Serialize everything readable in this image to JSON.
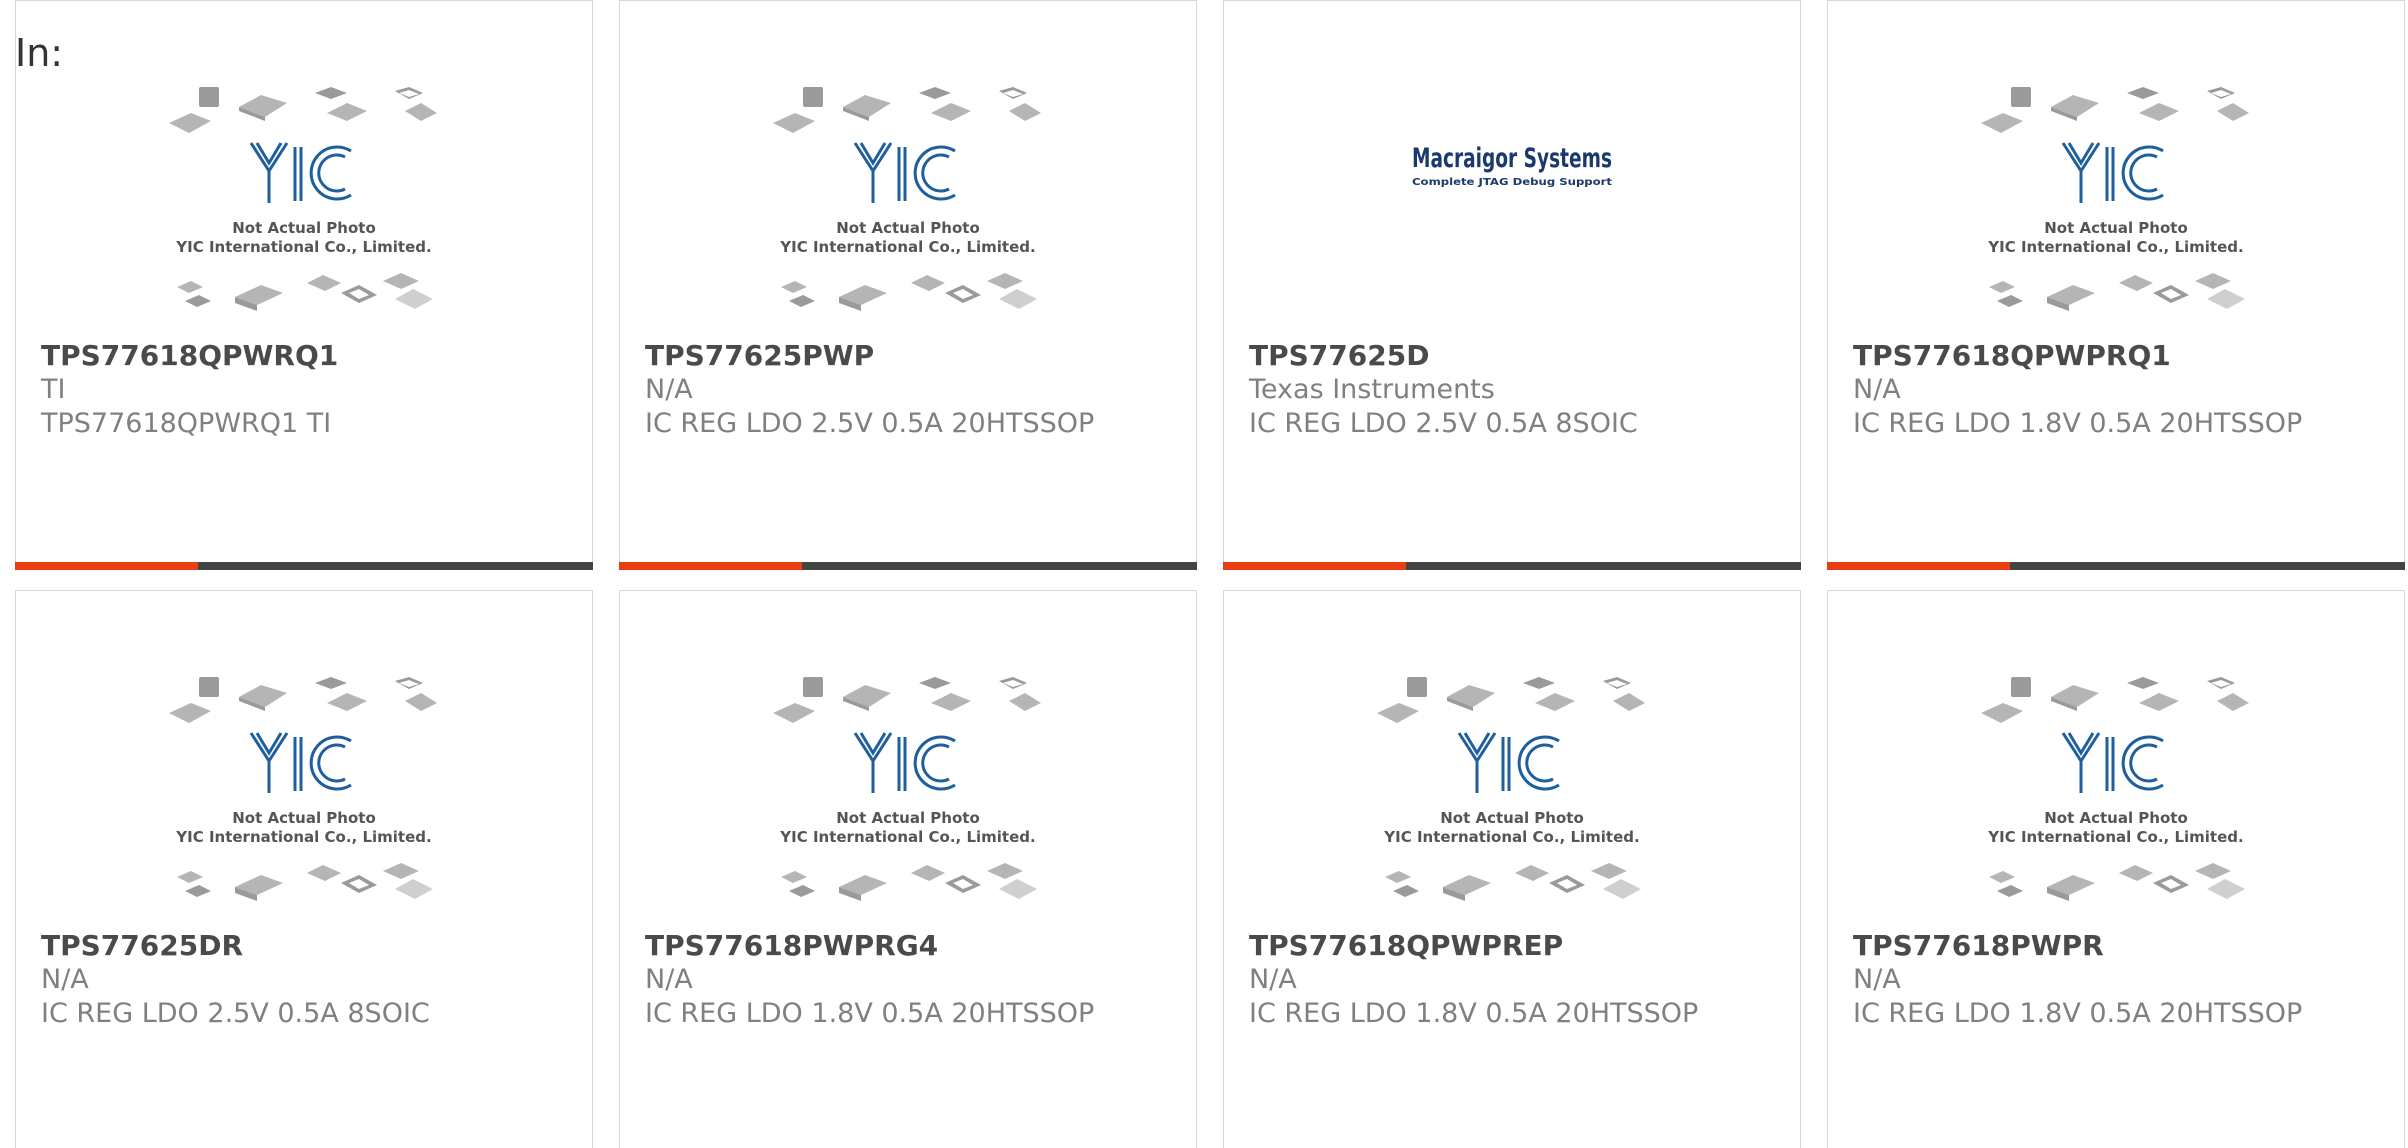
{
  "header": {
    "label": "In:"
  },
  "colors": {
    "accent": "#ea3c12",
    "bar": "#444444",
    "logo_blue": "#1f5f9e"
  },
  "placeholder_image": {
    "line1": "Not Actual Photo",
    "line2": "YIC International Co., Limited."
  },
  "mfr_logo": {
    "name": "Macraigor Systems",
    "tagline": "Complete JTAG Debug Support"
  },
  "cards": [
    {
      "part_number": "TPS77618QPWRQ1",
      "manufacturer": "TI",
      "description": "TPS77618QPWRQ1 TI",
      "image": "placeholder",
      "has_bar": true
    },
    {
      "part_number": "TPS77625PWP",
      "manufacturer": "N/A",
      "description": "IC REG LDO 2.5V 0.5A 20HTSSOP",
      "image": "placeholder",
      "has_bar": true
    },
    {
      "part_number": "TPS77625D",
      "manufacturer": "Texas Instruments",
      "description": "IC REG LDO 2.5V 0.5A 8SOIC",
      "image": "macraigor-logo",
      "has_bar": true
    },
    {
      "part_number": "TPS77618QPWPRQ1",
      "manufacturer": "N/A",
      "description": "IC REG LDO 1.8V 0.5A 20HTSSOP",
      "image": "placeholder",
      "has_bar": true
    },
    {
      "part_number": "TPS77625DR",
      "manufacturer": "N/A",
      "description": "IC REG LDO 2.5V 0.5A 8SOIC",
      "image": "placeholder",
      "has_bar": false
    },
    {
      "part_number": "TPS77618PWPRG4",
      "manufacturer": "N/A",
      "description": "IC REG LDO 1.8V 0.5A 20HTSSOP",
      "image": "placeholder",
      "has_bar": false
    },
    {
      "part_number": "TPS77618QPWPREP",
      "manufacturer": "N/A",
      "description": "IC REG LDO 1.8V 0.5A 20HTSSOP",
      "image": "placeholder",
      "has_bar": false
    },
    {
      "part_number": "TPS77618PWPR",
      "manufacturer": "N/A",
      "description": "IC REG LDO 1.8V 0.5A 20HTSSOP",
      "image": "placeholder",
      "has_bar": false
    }
  ]
}
